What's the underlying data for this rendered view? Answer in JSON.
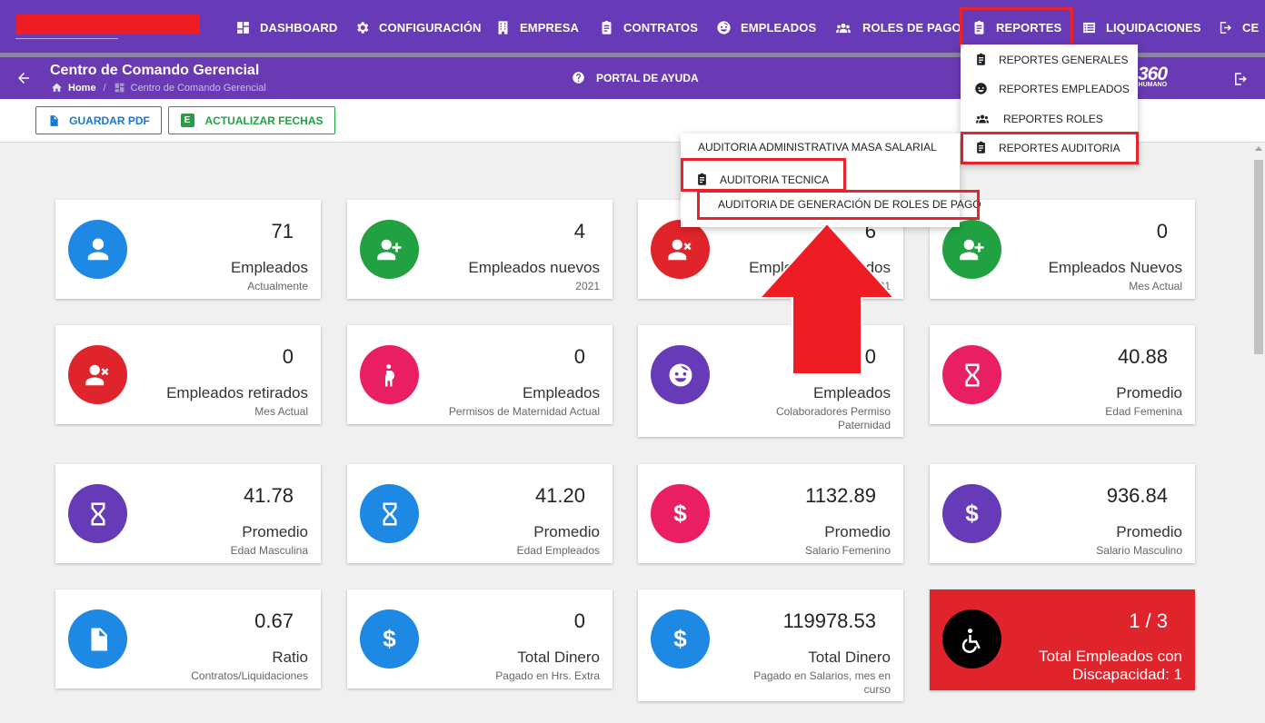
{
  "nav": {
    "items": [
      {
        "label": "DASHBOARD",
        "icon": "dashboard-icon"
      },
      {
        "label": "CONFIGURACIÓN",
        "icon": "gear-icon"
      },
      {
        "label": "EMPRESA",
        "icon": "building-icon"
      },
      {
        "label": "CONTRATOS",
        "icon": "clipboard-icon"
      },
      {
        "label": "EMPLEADOS",
        "icon": "face-icon"
      },
      {
        "label": "ROLES DE PAGO",
        "icon": "users-icon"
      },
      {
        "label": "REPORTES",
        "icon": "clipboard-icon"
      },
      {
        "label": "LIQUIDACIONES",
        "icon": "list-icon"
      },
      {
        "label": "CE",
        "icon": "logout-icon"
      }
    ]
  },
  "header": {
    "title": "Centro de Comando Gerencial",
    "breadcrumb_home": "Home",
    "breadcrumb_separator": "/",
    "breadcrumb_current": "Centro de Comando Gerencial",
    "help_label": "PORTAL DE AYUDA",
    "brand_main": "360",
    "brand_sub": "HUMANO"
  },
  "toolbar": {
    "pdf_label": "GUARDAR PDF",
    "dates_label": "ACTUALIZAR FECHAS",
    "dates_icon_letter": "E"
  },
  "reportes_menu": {
    "items": [
      {
        "label": "REPORTES GENERALES"
      },
      {
        "label": "REPORTES EMPLEADOS"
      },
      {
        "label": "REPORTES ROLES"
      },
      {
        "label": "REPORTES AUDITORIA"
      }
    ]
  },
  "auditoria_menu": {
    "items": [
      {
        "label": "AUDITORIA ADMINISTRATIVA MASA SALARIAL"
      },
      {
        "label": "AUDITORIA TECNICA"
      },
      {
        "label": "AUDITORIA DE GENERACIÓN DE ROLES DE PAGO"
      }
    ]
  },
  "cards": [
    {
      "value": "71",
      "label": "Empleados",
      "sub": "Actualmente",
      "color": "#1e88e5",
      "icon": "user-icon"
    },
    {
      "value": "4",
      "label": "Empleados nuevos",
      "sub": "2021",
      "color": "#21a142",
      "icon": "user-add-icon"
    },
    {
      "value": "6",
      "label": "Empleados retirados",
      "sub": "2021",
      "color": "#e0242c",
      "icon": "user-remove-icon"
    },
    {
      "value": "0",
      "label": "Empleados Nuevos",
      "sub": "Mes Actual",
      "color": "#21a142",
      "icon": "user-add-icon"
    },
    {
      "value": "0",
      "label": "Empleados retirados",
      "sub": "Mes Actual",
      "color": "#e0242c",
      "icon": "user-remove-icon"
    },
    {
      "value": "0",
      "label": "Empleados",
      "sub": "Permisos de Maternidad Actual",
      "color": "#e91e63",
      "icon": "pregnant-icon"
    },
    {
      "value": "0",
      "label": "Empleados",
      "sub": "Colaboradores Permiso Paternidad",
      "color": "#673ab7",
      "icon": "face-icon"
    },
    {
      "value": "40.88",
      "label": "Promedio",
      "sub": "Edad Femenina",
      "color": "#e91e63",
      "icon": "hourglass-icon"
    },
    {
      "value": "41.78",
      "label": "Promedio",
      "sub": "Edad Masculina",
      "color": "#673ab7",
      "icon": "hourglass-icon"
    },
    {
      "value": "41.20",
      "label": "Promedio",
      "sub": "Edad Empleados",
      "color": "#1e88e5",
      "icon": "hourglass-icon"
    },
    {
      "value": "1132.89",
      "label": "Promedio",
      "sub": "Salario Femenino",
      "color": "#e91e63",
      "icon": "dollar-icon"
    },
    {
      "value": "936.84",
      "label": "Promedio",
      "sub": "Salario Masculino",
      "color": "#673ab7",
      "icon": "dollar-icon"
    },
    {
      "value": "0.67",
      "label": "Ratio",
      "sub": "Contratos/Liquidaciones",
      "color": "#1e88e5",
      "icon": "document-icon"
    },
    {
      "value": "0",
      "label": "Total Dinero",
      "sub": "Pagado en Hrs. Extra",
      "color": "#1e88e5",
      "icon": "dollar-icon"
    },
    {
      "value": "119978.53",
      "label": "Total Dinero",
      "sub": "Pagado en Salarios, mes en curso",
      "color": "#1e88e5",
      "icon": "dollar-icon"
    },
    {
      "value": "1 / 3",
      "label": "Total Empleados con Discapacidad: 1",
      "sub": "",
      "color": "#000000",
      "icon": "wheelchair-icon"
    }
  ],
  "dollar_glyph": "$"
}
